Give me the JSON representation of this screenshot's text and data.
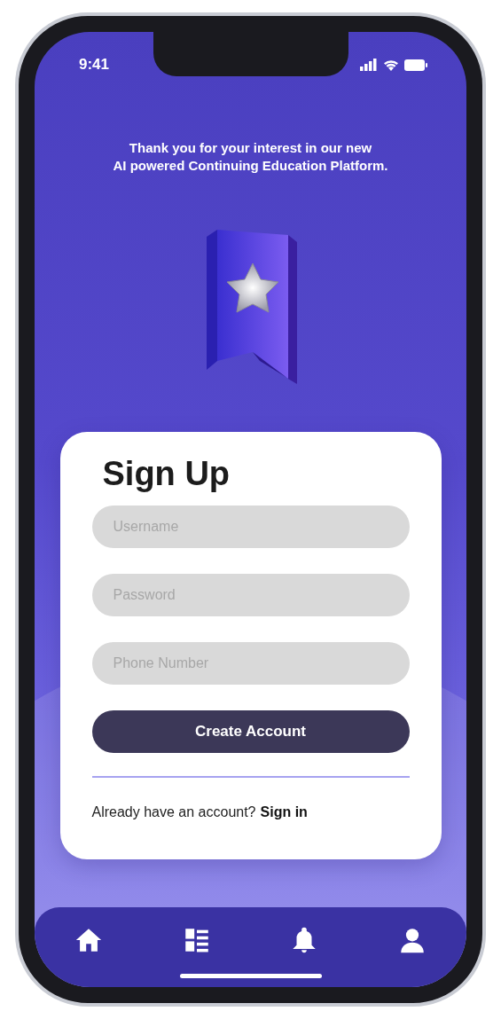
{
  "status_bar": {
    "time": "9:41"
  },
  "intro": {
    "lines": [
      "Thank you for your interest in our new",
      "AI powered Continuing Education Platform."
    ]
  },
  "card": {
    "title": "Sign Up",
    "fields": [
      {
        "placeholder": "Username"
      },
      {
        "placeholder": "Password"
      },
      {
        "placeholder": "Phone Number"
      }
    ],
    "button": "Create Account",
    "footer": {
      "prompt": "Already have an account?",
      "link": "Sign in"
    }
  },
  "tab_bar": {
    "items": [
      {
        "kind": "home"
      },
      {
        "kind": "list"
      },
      {
        "kind": "bell"
      },
      {
        "kind": "user"
      }
    ]
  }
}
